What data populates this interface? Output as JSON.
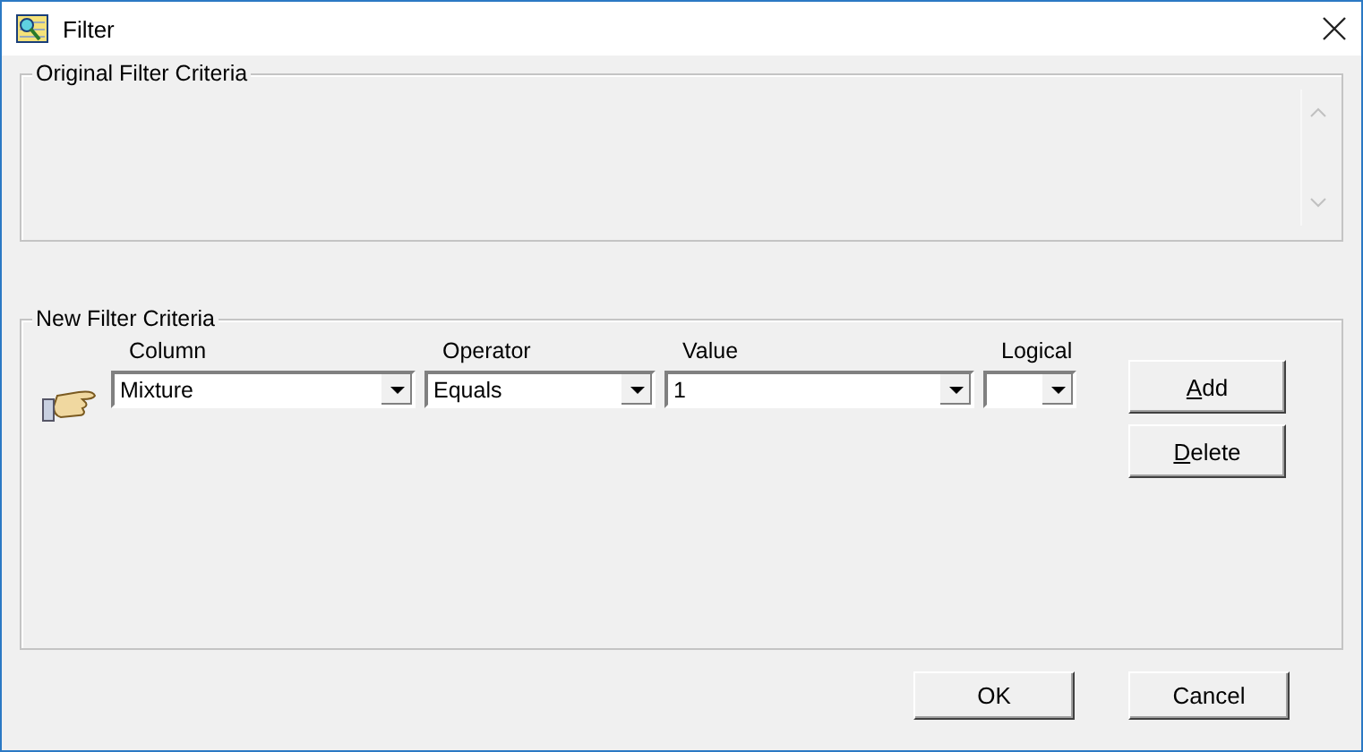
{
  "window": {
    "title": "Filter"
  },
  "original_criteria": {
    "title": "Original Filter Criteria"
  },
  "new_criteria": {
    "title": "New Filter Criteria",
    "fields": [
      {
        "label": "Column",
        "value": "Mixture"
      },
      {
        "label": "Operator",
        "value": "Equals"
      },
      {
        "label": "Value",
        "value": "1"
      },
      {
        "label": "Logical"
      }
    ],
    "buttons": [
      {
        "label": "Add",
        "underline_first": true
      },
      {
        "label": "Delete",
        "underline_first": true
      }
    ]
  },
  "buttons": [
    {
      "label": "OK"
    },
    {
      "label": "Cancel"
    }
  ]
}
